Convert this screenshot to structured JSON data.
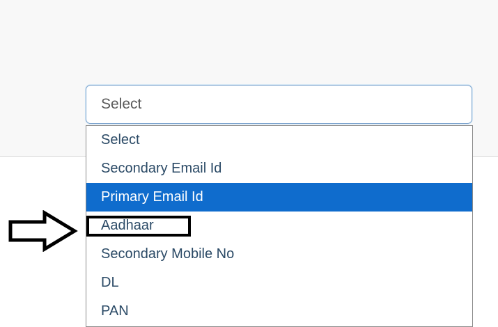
{
  "select": {
    "value": "Select",
    "options": [
      "Select",
      "Secondary Email Id",
      "Primary Email Id",
      "Aadhaar",
      "Secondary Mobile No",
      "DL",
      "PAN"
    ],
    "highlighted_option": "Primary Email Id",
    "annotated_option": "Aadhaar"
  },
  "colors": {
    "highlight": "#0f6ccd",
    "option_text": "#2b4a66",
    "annotation": "#000000"
  },
  "icons": {
    "annotation": "right-arrow-icon"
  }
}
